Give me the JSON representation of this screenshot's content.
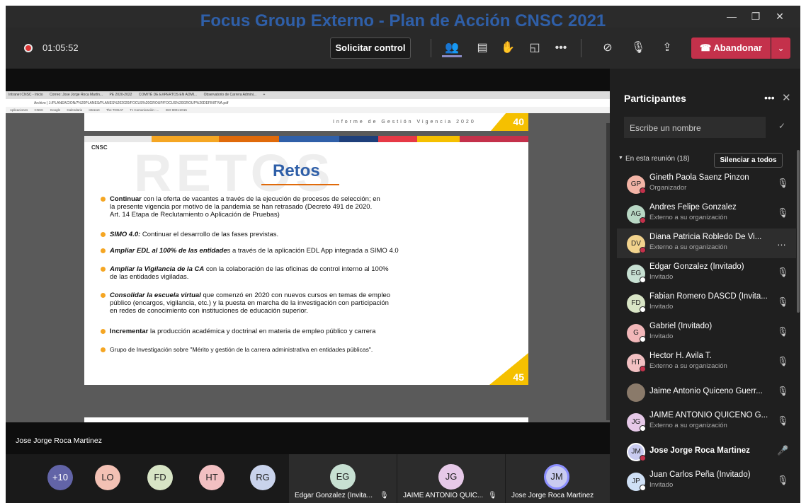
{
  "window": {
    "title": "Focus Group Externo - Plan de Acción CNSC 2021"
  },
  "toolbar": {
    "timer": "01:05:52",
    "request_control": "Solicitar control",
    "leave": "Abandonar"
  },
  "browser": {
    "tabs": [
      "Intranet CNSC - Inicio",
      "Correo: Jose Jorge Roca Martin...",
      "PE 2020-2022",
      "COMITÉ DE EXPERTOS EN ADMI...",
      "Observatorio de Carrera Admini...",
      "+"
    ],
    "address": "Archivo | J:/PLANEACION/7%20PLANES/PLANES%202020/FOCUS%20GROUP/FOCUS%20GROUP%20DEFINITIVA.pdf",
    "bookmarks": [
      "Aplicaciones",
      "CNSC",
      "Google",
      "Calendario",
      "Intranet",
      "The TOGAF",
      "T.I Comunicación -...",
      "ISO 9001:2015"
    ]
  },
  "doc": {
    "page1_header": "Informe de Gestión Vigencia 2020",
    "page1_number": "40",
    "watermark": "RETOS",
    "logo": "CNSC",
    "slide_title": "Retos",
    "bullets": [
      {
        "bold": "Continuar",
        "text": " con la oferta de vacantes a través de la ejecución de procesos de selección; en",
        "line2": "la presente vigencia por motivo de la pandemia se han retrasado  (Decreto 491 de 2020.",
        "line3": "Art. 14 Etapa de Reclutamiento o Aplicación de Pruebas)"
      },
      {
        "bold": "SIMO 4.0:",
        "text": " Continuar el desarrollo de las fases previstas."
      },
      {
        "bold": "Ampliar EDL al 100% de las entidade",
        "text": "s a través de la aplicación EDL App integrada a SIMO 4.0"
      },
      {
        "bold": "Ampliar la Vigilancia de la CA",
        "text": " con la colaboración de las oficinas de control interno al 100%",
        "line2": "de las entidades vigiladas."
      },
      {
        "bold": "Consolidar la escuela virtual",
        "text": " que comenzó en 2020 con nuevos cursos en temas de empleo",
        "line2": "público (encargos, vigilancia, etc.) y la puesta en marcha de la investigación con participación",
        "line3": "en redes de conocimiento con instituciones de educación superior."
      },
      {
        "bold": "Incrementar",
        "text": " la producción académica y doctrinal en materia de empleo público y carrera"
      },
      {
        "bold": "",
        "text": "Grupo de Investigación sobre \"Mérito y gestión de la carrera administrativa en entidades públicas\"."
      }
    ],
    "page_number": "45"
  },
  "presenter_label": "Jose Jorge Roca Martinez",
  "panel": {
    "title": "Participantes",
    "search_placeholder": "Escribe un nombre",
    "section": "En esta reunión (18)",
    "mute_all": "Silenciar a todos",
    "participants": [
      {
        "initials": "GP",
        "name": "Gineth Paola Saenz Pinzon",
        "role": "Organizador",
        "color": "#f3b4a6",
        "status": "#c4314b"
      },
      {
        "initials": "AG",
        "name": "Andres Felipe Gonzalez",
        "role": "Externo a su organización",
        "color": "#b8d7c4",
        "status": "#c4314b"
      },
      {
        "initials": "DV",
        "name": "Diana Patricia Robledo De Vi...",
        "role": "Externo a su organización",
        "color": "#f2d38d",
        "status": "#c4314b"
      },
      {
        "initials": "EG",
        "name": "Edgar Gonzalez (Invitado)",
        "role": "Invitado",
        "color": "#c7e0d2",
        "status": "#fff"
      },
      {
        "initials": "FD",
        "name": "Fabian Romero DASCD (Invita...",
        "role": "Invitado",
        "color": "#d9e5c6",
        "status": "#fff"
      },
      {
        "initials": "G",
        "name": "Gabriel (Invitado)",
        "role": "Invitado",
        "color": "#f2b7b9",
        "status": "#fff"
      },
      {
        "initials": "HT",
        "name": "Hector H. Avila T.",
        "role": "Externo a su organización",
        "color": "#f2c0c2",
        "status": "#c4314b"
      },
      {
        "initials": "",
        "name": "Jaime Antonio Quiceno Guerr...",
        "role": "",
        "color": "#8a7a6a",
        "status": ""
      },
      {
        "initials": "JG",
        "name": "JAIME ANTONIO QUICENO G...",
        "role": "Externo a su organización",
        "color": "#e6c9e8",
        "status": "#fff"
      },
      {
        "initials": "JM",
        "name": "Jose Jorge Roca Martinez",
        "role": "",
        "color": "#c9cbf0",
        "status": "#c4314b"
      },
      {
        "initials": "JP",
        "name": "Juan Carlos Peña (Invitado)",
        "role": "Invitado",
        "color": "#cfe0f5",
        "status": "#fff"
      }
    ]
  },
  "bottom": {
    "overflow": "+10",
    "avatars": [
      {
        "initials": "LO",
        "color": "#f3c1b4"
      },
      {
        "initials": "FD",
        "color": "#d7e4c5"
      },
      {
        "initials": "HT",
        "color": "#f2c0c2"
      },
      {
        "initials": "RG",
        "color": "#c9d3ec"
      }
    ],
    "tiles": [
      {
        "initials": "EG",
        "name": "Edgar Gonzalez (Invita...",
        "color": "#c7e0d2"
      },
      {
        "initials": "JG",
        "name": "JAIME ANTONIO QUIC...",
        "color": "#e6c9e8"
      },
      {
        "initials": "JM",
        "name": "Jose Jorge Roca Martinez",
        "color": "#c9cbf0"
      }
    ]
  }
}
